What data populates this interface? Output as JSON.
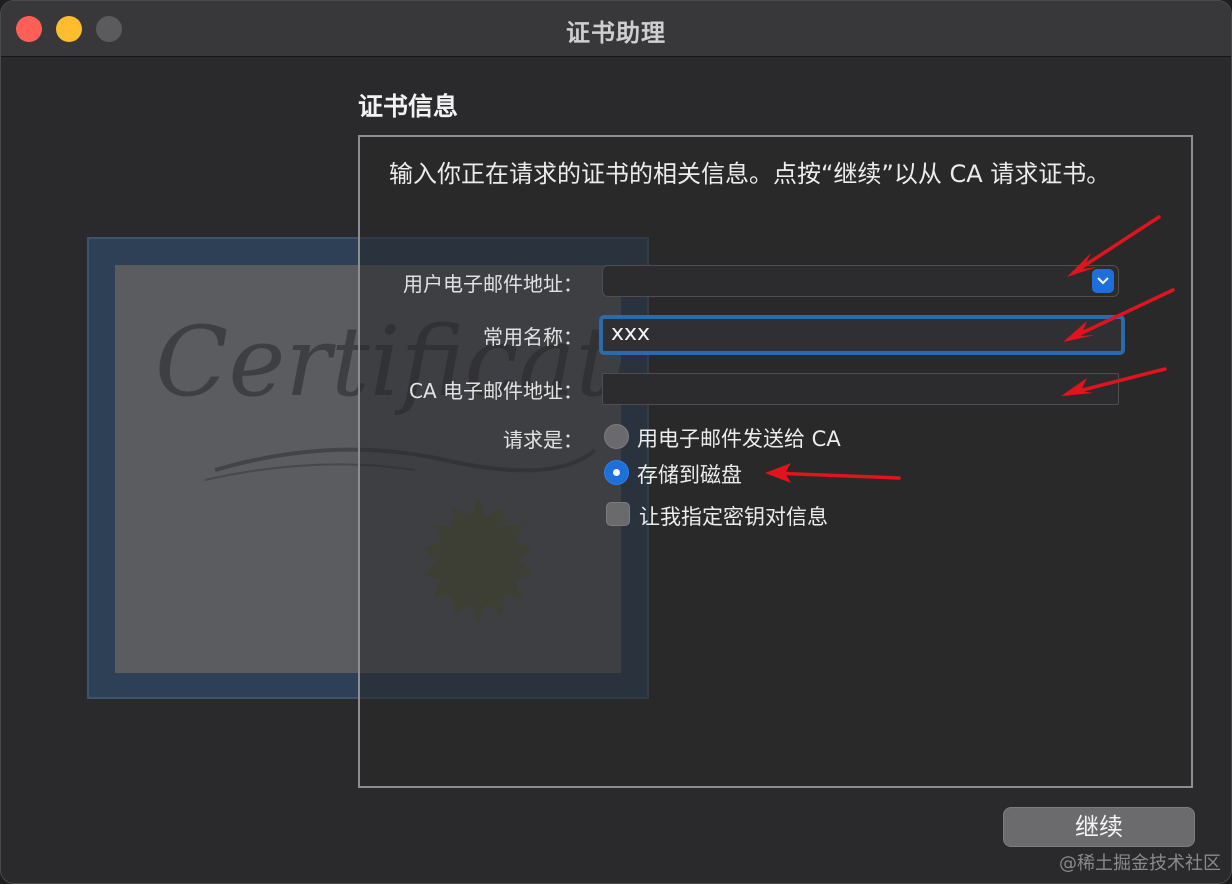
{
  "window": {
    "title": "证书助理"
  },
  "artwork": {
    "script_text": "Certificate"
  },
  "section": {
    "title": "证书信息",
    "description": "输入你正在请求的证书的相关信息。点按“继续”以从 CA 请求证书。"
  },
  "form": {
    "email": {
      "label": "用户电子邮件地址：",
      "value": ""
    },
    "common_name": {
      "label": "常用名称：",
      "value": "xxx"
    },
    "ca_email": {
      "label": "CA 电子邮件地址：",
      "value": ""
    },
    "request": {
      "label": "请求是：",
      "options": [
        {
          "label": "用电子邮件发送给 CA",
          "checked": false
        },
        {
          "label": "存储到磁盘",
          "checked": true
        }
      ]
    },
    "custom_key": {
      "label": "让我指定密钥对信息",
      "checked": false
    }
  },
  "buttons": {
    "continue": "继续"
  },
  "watermark": "@稀土掘金技术社区",
  "colors": {
    "accent": "#1f6fdb",
    "annotation": "#e0141c"
  }
}
